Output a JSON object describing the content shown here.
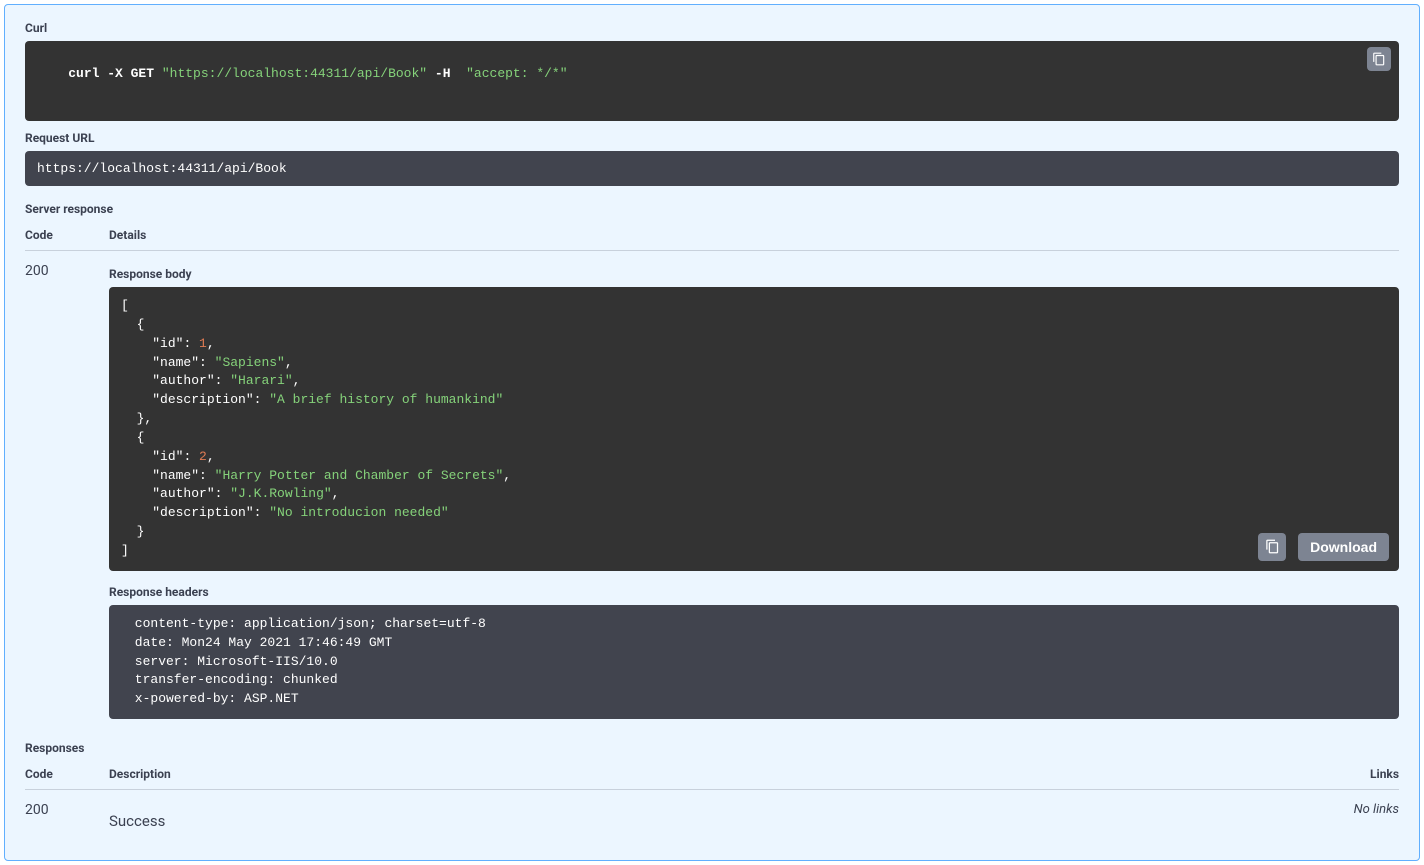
{
  "sections": {
    "curl": "Curl",
    "request_url": "Request URL",
    "server_response": "Server response",
    "response_body": "Response body",
    "response_headers": "Response headers",
    "responses": "Responses"
  },
  "columns": {
    "code": "Code",
    "details": "Details",
    "description": "Description",
    "links": "Links"
  },
  "curl_parts": {
    "cmd": "curl -X GET ",
    "url": "\"https://localhost:44311/api/Book\"",
    "flag": " -H  ",
    "header": "\"accept: */*\""
  },
  "request_url_value": "https://localhost:44311/api/Book",
  "server_response": {
    "code": "200"
  },
  "response_body_items": [
    {
      "id": 1,
      "name": "Sapiens",
      "author": "Harari",
      "description": "A brief history of humankind"
    },
    {
      "id": 2,
      "name": "Harry Potter and Chamber of Secrets",
      "author": "J.K.Rowling",
      "description": "No introducion needed"
    }
  ],
  "response_headers_lines": [
    " content-type: application/json; charset=utf-8 ",
    " date: Mon24 May 2021 17:46:49 GMT ",
    " server: Microsoft-IIS/10.0 ",
    " transfer-encoding: chunked ",
    " x-powered-by: ASP.NET "
  ],
  "download_label": "Download",
  "responses_table": {
    "code": "200",
    "description": "Success",
    "links_text": "No links"
  }
}
